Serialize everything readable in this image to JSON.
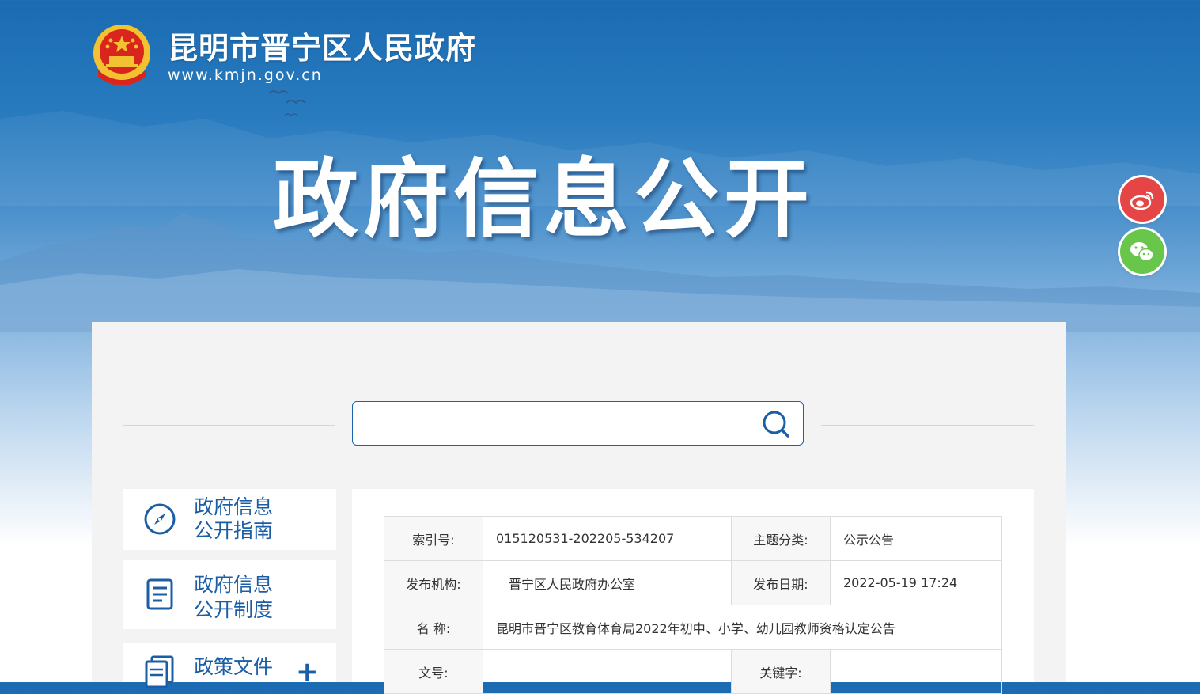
{
  "header": {
    "site_title": "昆明市晋宁区人民政府",
    "site_url": "www.kmjn.gov.cn",
    "page_title": "政府信息公开"
  },
  "share": {
    "weibo_icon": "weibo-icon",
    "wechat_icon": "wechat-icon"
  },
  "search": {
    "placeholder": "",
    "value": ""
  },
  "sidebar": {
    "items": [
      {
        "line1": "政府信息",
        "line2": "公开指南",
        "icon": "compass-icon"
      },
      {
        "line1": "政府信息",
        "line2": "公开制度",
        "icon": "document-list-icon"
      },
      {
        "line1": "政策文件",
        "icon": "files-icon",
        "expand": "+"
      }
    ]
  },
  "meta": {
    "index_label": "索引号:",
    "index_value": "015120531-202205-534207",
    "topic_label": "主题分类:",
    "topic_value": "公示公告",
    "publisher_label": "发布机构:",
    "publisher_value": "晋宁区人民政府办公室",
    "date_label": "发布日期:",
    "date_value": "2022-05-19 17:24",
    "name_label": "名 称:",
    "name_value": "昆明市晋宁区教育体育局2022年初中、小学、幼儿园教师资格认定公告",
    "docno_label": "文号:",
    "docno_value": "",
    "keyword_label": "关键字:",
    "keyword_value": ""
  },
  "colors": {
    "primary_blue": "#1b5ea6",
    "weibo_red": "#e54545",
    "wechat_green": "#68c64a"
  }
}
